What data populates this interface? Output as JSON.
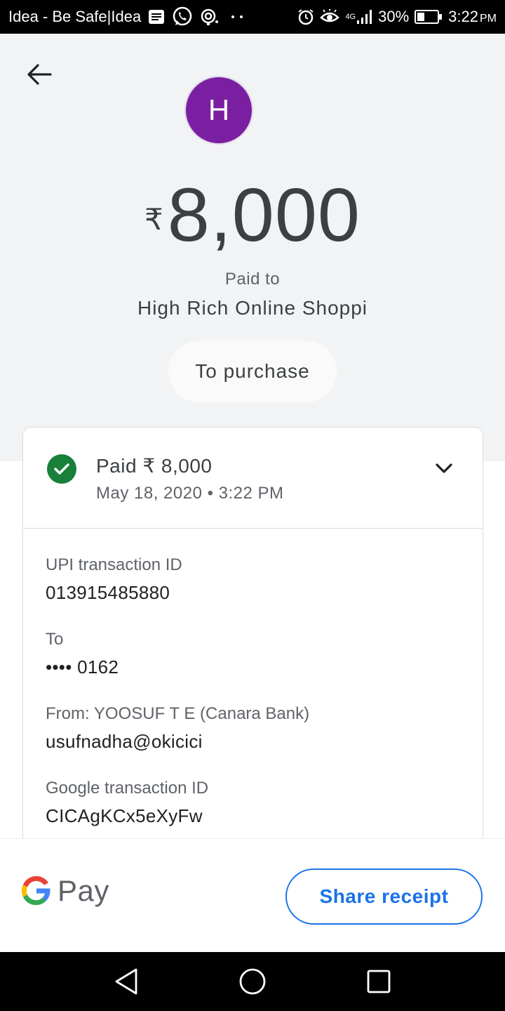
{
  "status_bar": {
    "carrier": "Idea - Be Safe|Idea",
    "network": "4G",
    "battery": "30%",
    "time": "3:22",
    "ampm": "PM",
    "icons": [
      "message-icon",
      "whatsapp-icon",
      "hotspot-icon",
      "alarm-icon",
      "eye-icon",
      "signal-icon",
      "battery-icon"
    ]
  },
  "header": {
    "avatar_letter": "H",
    "avatar_color": "#7b1fa2",
    "currency_symbol": "₹",
    "amount": "8,000",
    "paid_to_label": "Paid to",
    "payee_name": "High Rich Online Shoppi",
    "note": "To purchase"
  },
  "card": {
    "status": "Paid ₹ 8,000",
    "datetime": "May 18, 2020 • 3:22 PM",
    "status_color": "#188038",
    "fields": [
      {
        "label": "UPI transaction ID",
        "value": "013915485880"
      },
      {
        "label": "To",
        "value": "•••• 0162"
      },
      {
        "label": "From: YOOSUF T E (Canara Bank)",
        "value": "usufnadha@okicici"
      },
      {
        "label": "Google transaction ID",
        "value": "CICAgKCx5eXyFw"
      }
    ]
  },
  "footer": {
    "brand": "Pay",
    "share_label": "Share receipt",
    "accent": "#1a73e8"
  }
}
